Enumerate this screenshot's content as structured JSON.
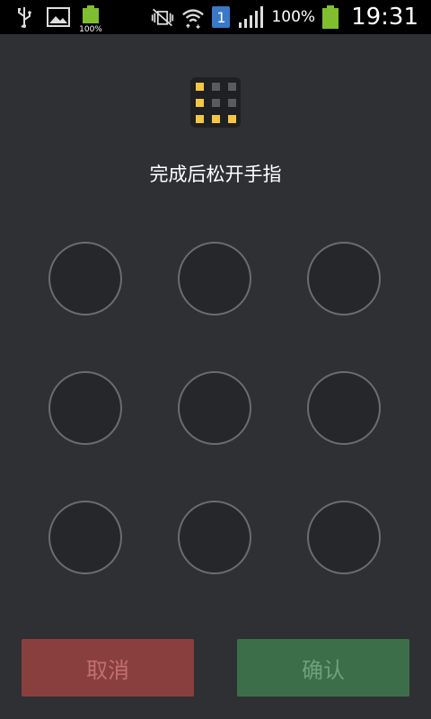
{
  "status_bar": {
    "usb_icon": "usb-icon",
    "gallery_icon": "gallery-icon",
    "battery_small_label": "100%",
    "battery_percent": "100%",
    "sim_number": "1",
    "time": "19:31"
  },
  "lock": {
    "title": "完成后松开手指"
  },
  "buttons": {
    "cancel": "取消",
    "confirm": "确认"
  },
  "colors": {
    "background": "#2f3033",
    "cancel_button": "#8a3f3f",
    "confirm_button": "#3d6e4a",
    "lock_dot_yellow": "#f5c543",
    "sim_blue": "#3a78c8"
  }
}
